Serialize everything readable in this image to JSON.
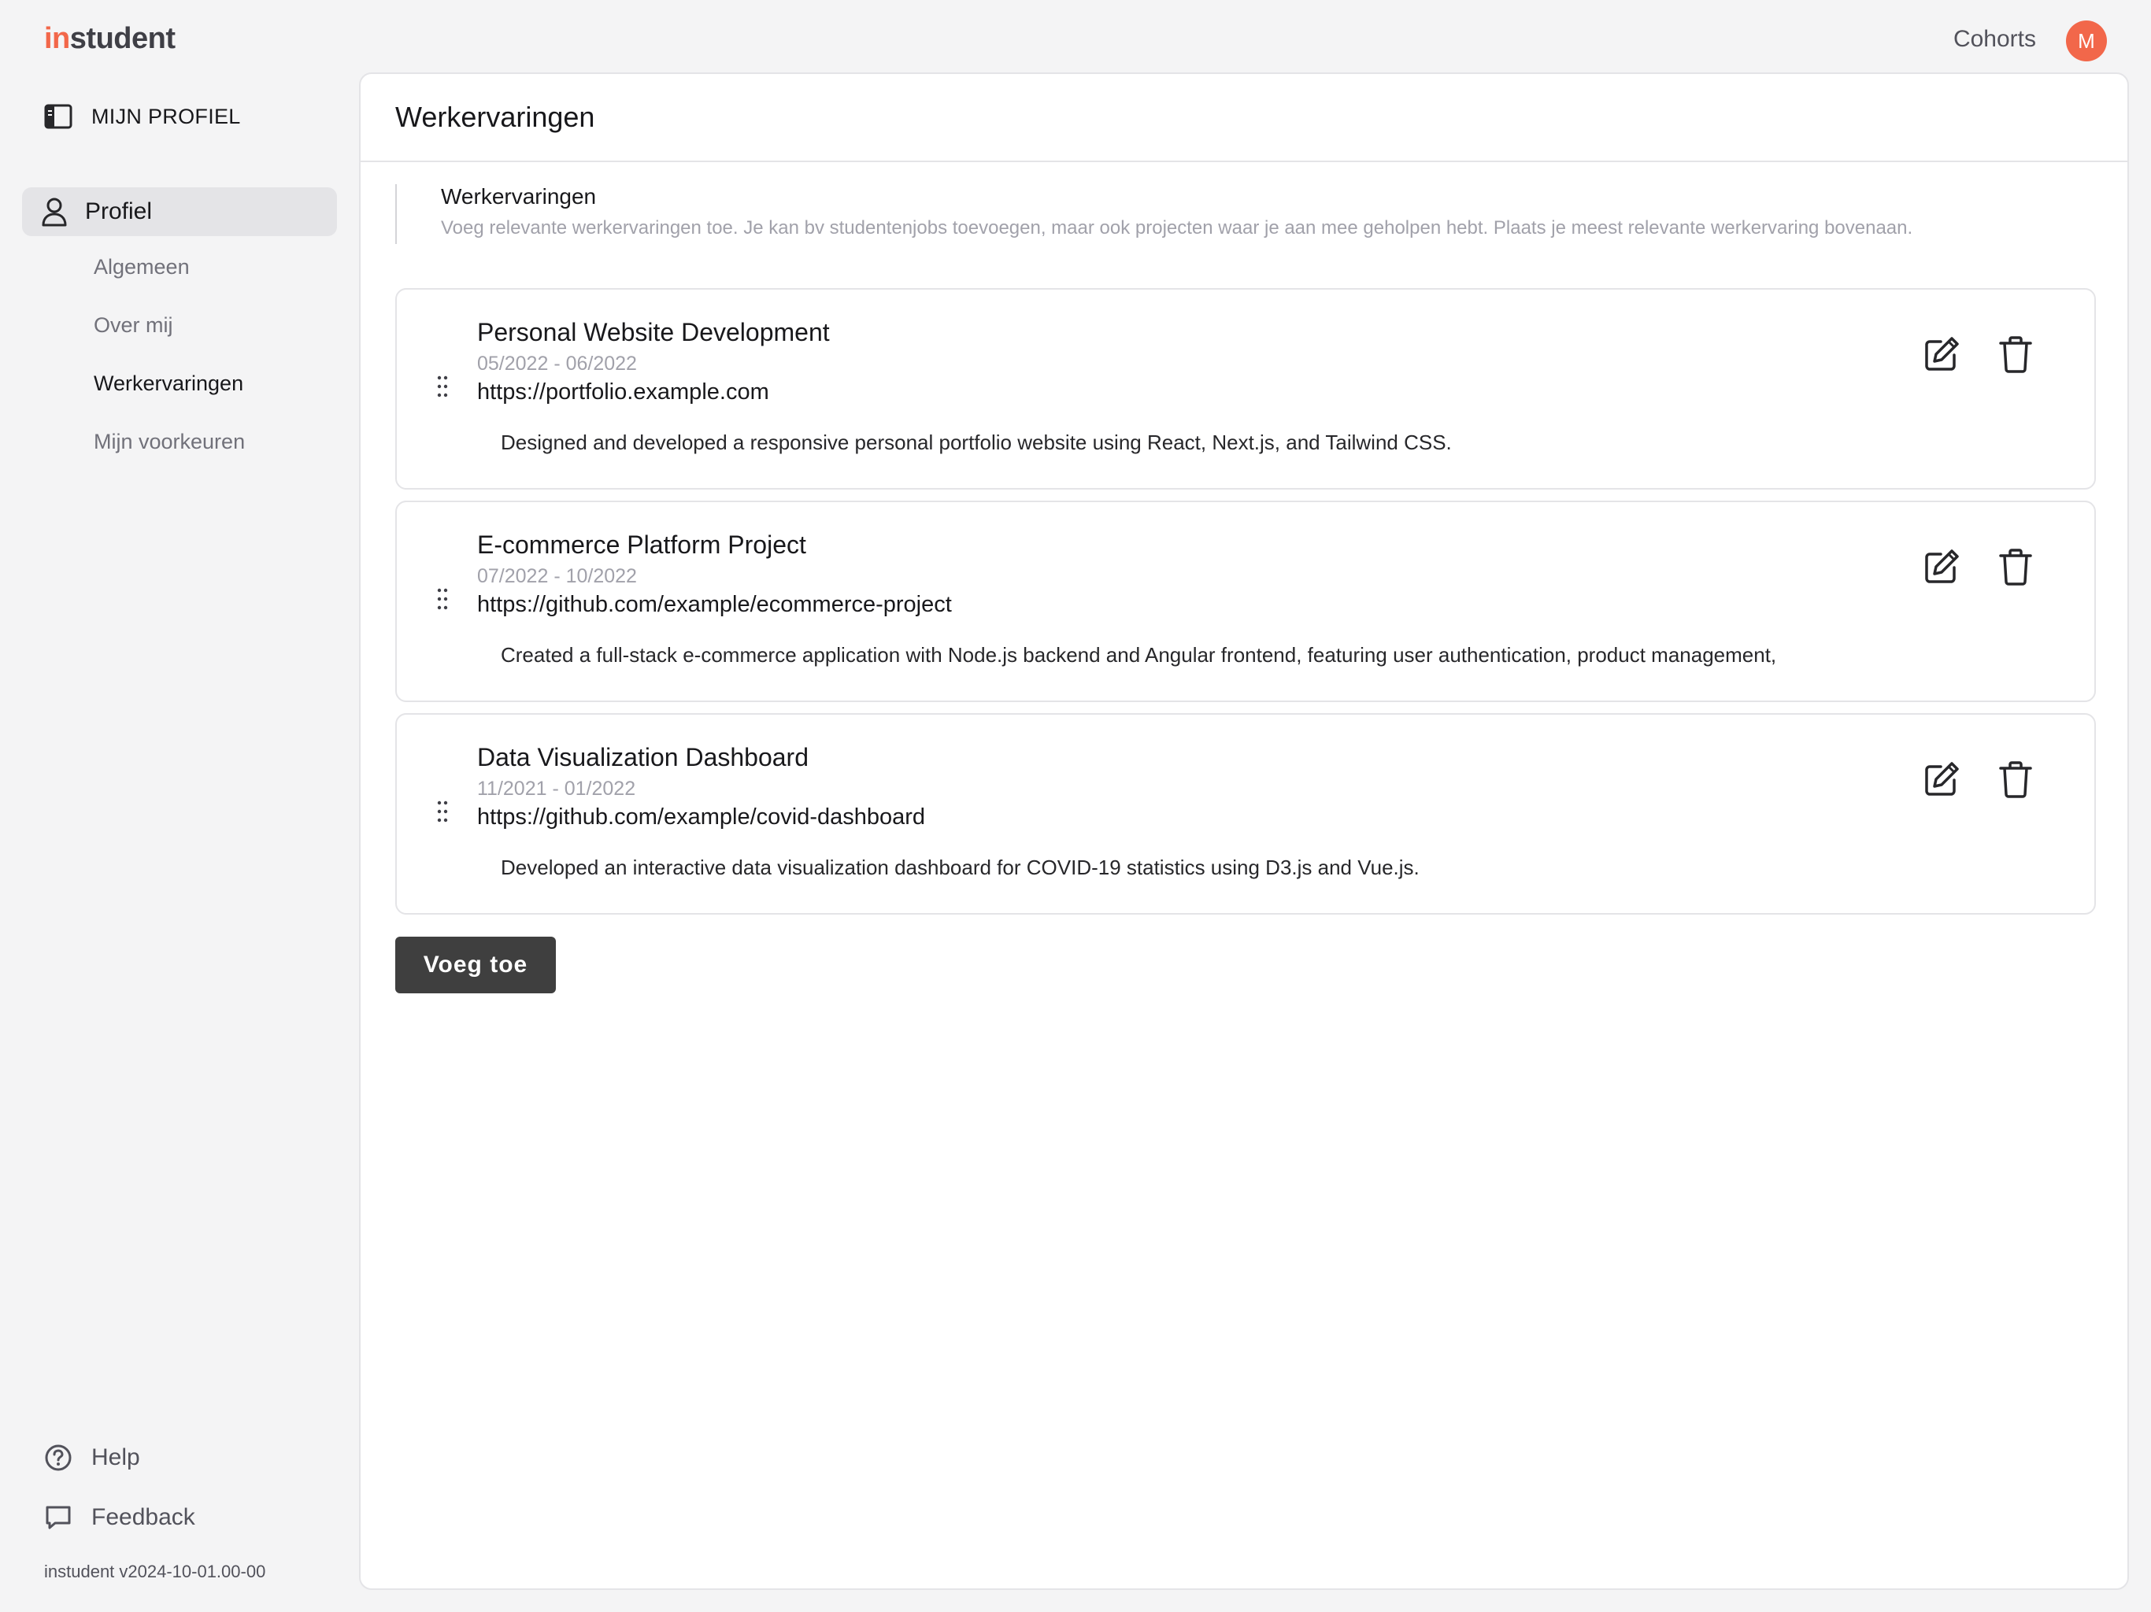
{
  "app": {
    "logo_prefix": "in",
    "logo_suffix": "student",
    "nav_cohorts": "Cohorts",
    "avatar_initial": "M",
    "accent_color": "#f2674a"
  },
  "sidebar": {
    "header_label": "MIJN PROFIEL",
    "active_item": "Profiel",
    "sub_items": [
      "Algemeen",
      "Over mij",
      "Werkervaringen",
      "Mijn voorkeuren"
    ],
    "current_sub_item": "Werkervaringen",
    "help_label": "Help",
    "feedback_label": "Feedback",
    "version": "instudent v2024-10-01.00-00"
  },
  "main": {
    "title": "Werkervaringen",
    "info_title": "Werkervaringen",
    "info_description": "Voeg relevante werkervaringen toe. Je kan bv studentenjobs toevoegen, maar ook projecten waar je aan mee geholpen hebt. Plaats je meest relevante werkervaring bovenaan.",
    "add_button": "Voeg toe"
  },
  "experiences": [
    {
      "title": "Personal Website Development",
      "dates": "05/2022 - 06/2022",
      "url": "https://portfolio.example.com",
      "description": "Designed and developed a responsive personal portfolio website using React, Next.js, and Tailwind CSS."
    },
    {
      "title": "E-commerce Platform Project",
      "dates": "07/2022 - 10/2022",
      "url": "https://github.com/example/ecommerce-project",
      "description": "Created a full-stack e-commerce application with Node.js backend and Angular frontend, featuring user authentication, product management,"
    },
    {
      "title": "Data Visualization Dashboard",
      "dates": "11/2021 - 01/2022",
      "url": "https://github.com/example/covid-dashboard",
      "description": "Developed an interactive data visualization dashboard for COVID-19 statistics using D3.js and Vue.js."
    }
  ],
  "icons": {
    "sidebar_header": "sidebar-panel-icon",
    "profile": "user-icon",
    "help": "help-circle-icon",
    "feedback": "message-square-icon",
    "drag": "drag-handle-icon",
    "edit": "edit-icon",
    "delete": "trash-icon"
  }
}
